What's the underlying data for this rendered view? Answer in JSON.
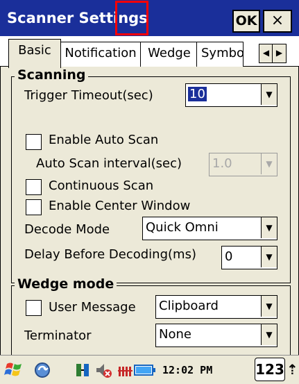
{
  "window": {
    "title": "Scanner Settings",
    "ok_label": "OK",
    "close_label": "×"
  },
  "tabs": [
    {
      "label": "Basic",
      "active": true
    },
    {
      "label": "Notification",
      "active": false
    },
    {
      "label": "Wedge",
      "active": false
    },
    {
      "label": "Symbo",
      "active": false
    }
  ],
  "tab_scroll": {
    "left": "◀",
    "right": "▶"
  },
  "scanning": {
    "group_title": "Scanning",
    "trigger_timeout_label": "Trigger Timeout(sec)",
    "trigger_timeout_value": "10",
    "enable_auto_scan_label": "Enable Auto Scan",
    "enable_auto_scan_checked": false,
    "auto_scan_interval_label": "Auto Scan interval(sec)",
    "auto_scan_interval_value": "1.0",
    "continuous_scan_label": "Continuous Scan",
    "continuous_scan_checked": false,
    "enable_center_window_label": "Enable Center Window",
    "enable_center_window_checked": false,
    "decode_mode_label": "Decode Mode",
    "decode_mode_value": "Quick Omni",
    "delay_before_decoding_label": "Delay Before Decoding(ms)",
    "delay_before_decoding_value": "0"
  },
  "wedge_mode": {
    "group_title": "Wedge mode",
    "user_message_label": "User Message",
    "user_message_checked": false,
    "user_message_value": "Clipboard",
    "terminator_label": "Terminator",
    "terminator_value": "None"
  },
  "taskbar": {
    "time": "12:02 PM",
    "keyboard_label": "123",
    "sip_arrow": "⇡"
  },
  "combo_arrow": "▼",
  "colors": {
    "title_bar": "#1a2f9a",
    "dialog_bg": "#ece9d8",
    "highlight_box": "#ff0000"
  }
}
